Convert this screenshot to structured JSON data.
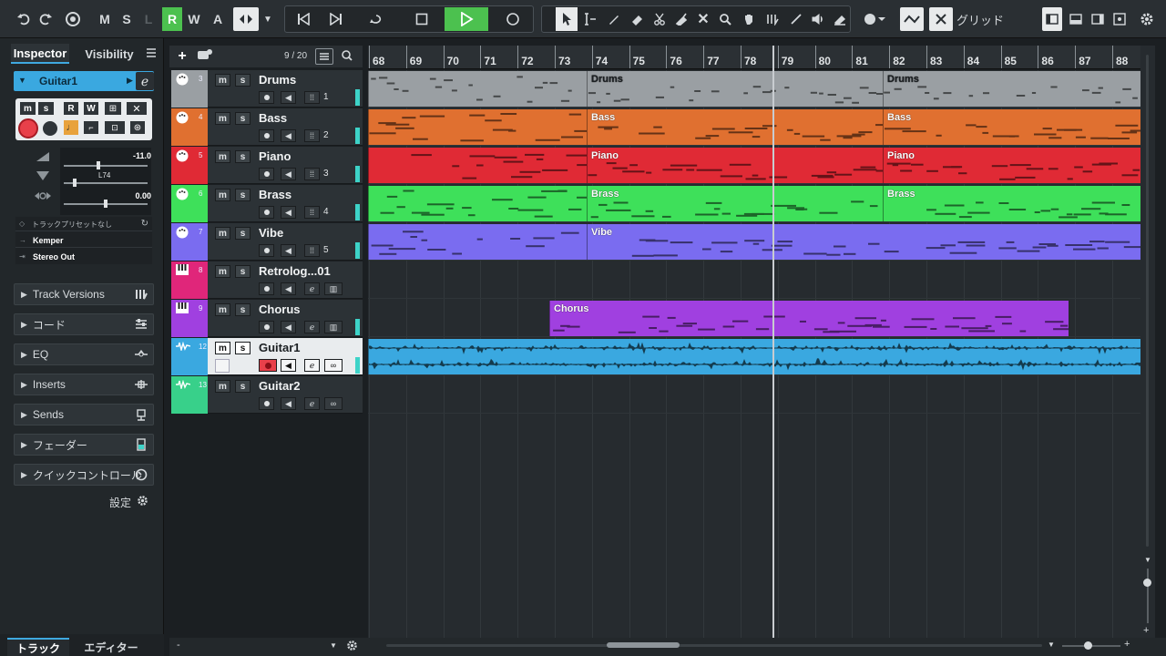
{
  "toolbar": {
    "m_label": "M",
    "s_label": "S",
    "l_label": "L",
    "r_label": "R",
    "w_label": "W",
    "a_label": "A",
    "snap_mode": "グリッド"
  },
  "inspector": {
    "tabs": [
      {
        "label": "Inspector"
      },
      {
        "label": "Visibility"
      }
    ],
    "track_name": "Guitar1",
    "volume_value": "-11.0",
    "pan_label": "L74",
    "delay_value": "0.00",
    "preset_label": "トラックプリセットなし",
    "input_routing": "Kemper",
    "output_routing": "Stereo Out",
    "sections": [
      {
        "label": "Track Versions"
      },
      {
        "label": "コード"
      },
      {
        "label": "EQ"
      },
      {
        "label": "Inserts"
      },
      {
        "label": "Sends"
      },
      {
        "label": "フェーダー"
      },
      {
        "label": "クイックコントロール"
      }
    ],
    "settings_label": "設定",
    "bottom_tabs": [
      {
        "label": "トラック"
      },
      {
        "label": "エディター"
      }
    ]
  },
  "tracklist": {
    "visible_count": "9 / 20",
    "tracks": [
      {
        "num": "3",
        "name": "Drums",
        "channel": "1",
        "color": "#9a9fa3"
      },
      {
        "num": "4",
        "name": "Bass",
        "channel": "2",
        "color": "#e07030"
      },
      {
        "num": "5",
        "name": "Piano",
        "channel": "3",
        "color": "#e02a35"
      },
      {
        "num": "6",
        "name": "Brass",
        "channel": "4",
        "color": "#3ee05a"
      },
      {
        "num": "7",
        "name": "Vibe",
        "channel": "5",
        "color": "#7a6cf0"
      },
      {
        "num": "8",
        "name": "Retrolog...01",
        "channel": "",
        "color": "#e0267a"
      },
      {
        "num": "9",
        "name": "Chorus",
        "channel": "",
        "color": "#a040e0"
      },
      {
        "num": "12",
        "name": "Guitar1",
        "channel": "",
        "color": "#3aa8e0"
      },
      {
        "num": "13",
        "name": "Guitar2",
        "channel": "",
        "color": "#38d08a"
      }
    ]
  },
  "ruler": {
    "bars": [
      "68",
      "69",
      "70",
      "71",
      "72",
      "73",
      "74",
      "75",
      "76",
      "77",
      "78",
      "79",
      "80",
      "81",
      "82",
      "83",
      "84",
      "85",
      "86",
      "87",
      "88"
    ]
  },
  "parts": {
    "drums_a": "Drums",
    "drums_b": "Drums",
    "bass_a": "Bass",
    "bass_b": "Bass",
    "piano_a": "Piano",
    "piano_b": "Piano",
    "brass_a": "Brass",
    "brass_b": "Brass",
    "vibe_a": "Vibe",
    "chorus": "Chorus"
  },
  "colors": {
    "accent_green": "#4cc14f",
    "drums": "#9a9fa3",
    "bass": "#e07030",
    "piano": "#e02a35",
    "brass": "#3ee05a",
    "vibe": "#7a6cf0",
    "chorus": "#a040e0",
    "guitar": "#3aa8e0"
  }
}
